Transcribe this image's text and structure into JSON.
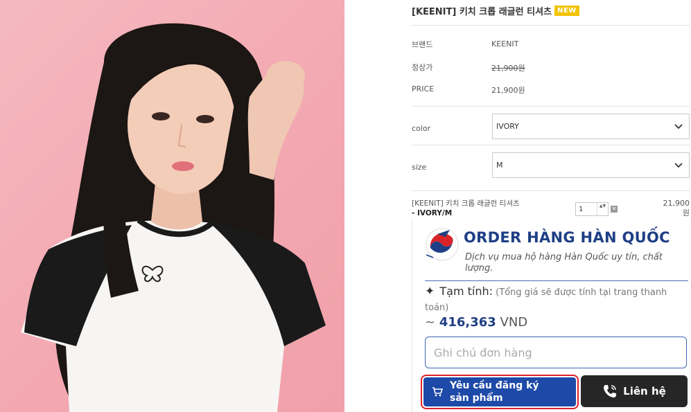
{
  "product": {
    "title": "[KEENIT] 키치 크롭 래글런 티셔츠",
    "badge": "NEW",
    "brand_label": "브랜드",
    "brand_value": "KEENIT",
    "regular_price_label": "정상가",
    "regular_price_value": "21,900원",
    "price_label": "PRICE",
    "price_value": "21,900원"
  },
  "options": {
    "color_label": "color",
    "color_value": "IVORY",
    "size_label": "size",
    "size_value": "M"
  },
  "selected_item": {
    "name": "[KEENIT] 키치 크롭 래글런 티셔츠",
    "variant": "- IVORY/M",
    "quantity": "1",
    "qty_arrows": "▲▼",
    "delete_glyph": "✕",
    "price": "21,900",
    "price_suffix": "원"
  },
  "widget": {
    "brand_name": "ORDER HÀNG HÀN QUỐC",
    "brand_description": "Dịch vụ mua hộ hàng Hàn Quốc uy tín, chất lượng.",
    "logo_text": "ORDER HÀNG HÀN QUỐC",
    "estimate_label": "Tạm tính:",
    "estimate_note": "(Tổng giá sẽ được tính tại trang thanh toán)",
    "estimate_tilde": "~",
    "estimate_value": "416,363",
    "estimate_currency": "VND",
    "note_placeholder": "Ghi chú đơn hàng",
    "order_button_label": "Yêu cầu đăng ký sản phẩm",
    "contact_button_label": "Liên hệ"
  },
  "colors": {
    "brand_blue": "#1e3f85",
    "button_blue": "#1d4aa8",
    "highlight_red": "#e0202a",
    "badge_yellow": "#f2c300",
    "contact_dark": "#262626"
  },
  "icons": {
    "chevron": "chevron-down-icon",
    "cart": "cart-icon",
    "phone": "phone-icon",
    "star": "sparkle-icon"
  }
}
